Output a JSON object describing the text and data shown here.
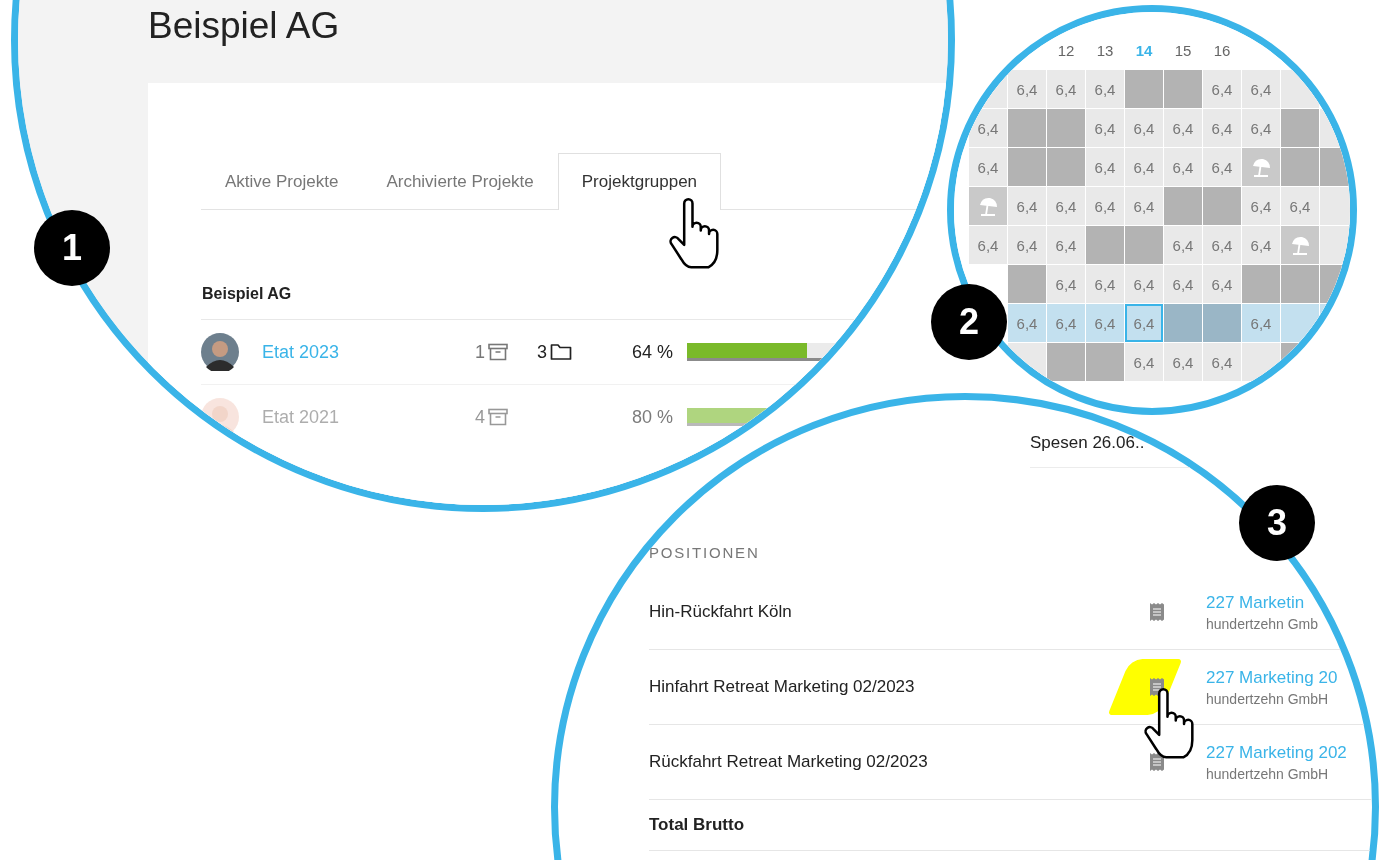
{
  "panel_1": {
    "badge": "1",
    "company_title": "Beispiel AG",
    "tabs": [
      {
        "label": "Aktive Projekte",
        "selected": false
      },
      {
        "label": "Archivierte Projekte",
        "selected": false
      },
      {
        "label": "Projektgruppen",
        "selected": true
      }
    ],
    "group": {
      "name": "Beispiel AG",
      "projects": [
        {
          "name": "Etat 2023",
          "archived_count": "1",
          "folder_count": "3",
          "percent": "64 %",
          "level": 0.64,
          "disabled": false
        },
        {
          "name": "Etat 2021",
          "archived_count": "4",
          "percent": "80 %",
          "level": 0.8,
          "disabled": true
        }
      ]
    }
  },
  "panel_2": {
    "badge": "2",
    "days": [
      {
        "label": "12",
        "today": false
      },
      {
        "label": "13",
        "today": false
      },
      {
        "label": "14",
        "today": true
      },
      {
        "label": "15",
        "today": false
      },
      {
        "label": "16",
        "today": false
      }
    ],
    "rows": [
      {
        "highlighted": false,
        "cells": [
          {
            "kind": "hours"
          },
          {
            "kind": "hours",
            "text": "6,4"
          },
          {
            "kind": "hours",
            "text": "6,4"
          },
          {
            "kind": "hours",
            "text": "6,4"
          },
          {
            "kind": "off"
          },
          {
            "kind": "off"
          },
          {
            "kind": "hours",
            "text": "6,4"
          },
          {
            "kind": "hours",
            "text": "6,4"
          },
          {
            "kind": "hours"
          },
          {
            "kind": "empty"
          }
        ]
      },
      {
        "highlighted": false,
        "cells": [
          {
            "kind": "hours",
            "text": "6,4"
          },
          {
            "kind": "off"
          },
          {
            "kind": "off"
          },
          {
            "kind": "hours",
            "text": "6,4"
          },
          {
            "kind": "hours",
            "text": "6,4"
          },
          {
            "kind": "hours",
            "text": "6,4"
          },
          {
            "kind": "hours",
            "text": "6,4"
          },
          {
            "kind": "hours",
            "text": "6,4"
          },
          {
            "kind": "off"
          },
          {
            "kind": "hours"
          }
        ]
      },
      {
        "highlighted": false,
        "cells": [
          {
            "kind": "hours",
            "text": "6,4"
          },
          {
            "kind": "off"
          },
          {
            "kind": "off"
          },
          {
            "kind": "hours",
            "text": "6,4"
          },
          {
            "kind": "hours",
            "text": "6,4"
          },
          {
            "kind": "hours",
            "text": "6,4"
          },
          {
            "kind": "hours",
            "text": "6,4"
          },
          {
            "kind": "vacation"
          },
          {
            "kind": "off"
          },
          {
            "kind": "off"
          }
        ]
      },
      {
        "highlighted": false,
        "cells": [
          {
            "kind": "vacation"
          },
          {
            "kind": "hours",
            "text": "6,4"
          },
          {
            "kind": "hours",
            "text": "6,4"
          },
          {
            "kind": "hours",
            "text": "6,4"
          },
          {
            "kind": "hours",
            "text": "6,4"
          },
          {
            "kind": "off"
          },
          {
            "kind": "off"
          },
          {
            "kind": "hours",
            "text": "6,4"
          },
          {
            "kind": "hours",
            "text": "6,4"
          },
          {
            "kind": "hours"
          }
        ]
      },
      {
        "highlighted": false,
        "cells": [
          {
            "kind": "hours",
            "text": "6,4"
          },
          {
            "kind": "hours",
            "text": "6,4"
          },
          {
            "kind": "hours",
            "text": "6,4"
          },
          {
            "kind": "off"
          },
          {
            "kind": "off"
          },
          {
            "kind": "hours",
            "text": "6,4"
          },
          {
            "kind": "hours",
            "text": "6,4"
          },
          {
            "kind": "hours",
            "text": "6,4"
          },
          {
            "kind": "vacation"
          },
          {
            "kind": "hours"
          }
        ]
      },
      {
        "highlighted": false,
        "cells": [
          {
            "kind": "empty"
          },
          {
            "kind": "off"
          },
          {
            "kind": "hours",
            "text": "6,4"
          },
          {
            "kind": "hours",
            "text": "6,4"
          },
          {
            "kind": "hours",
            "text": "6,4"
          },
          {
            "kind": "hours",
            "text": "6,4"
          },
          {
            "kind": "hours",
            "text": "6,4"
          },
          {
            "kind": "off"
          },
          {
            "kind": "off"
          },
          {
            "kind": "off"
          }
        ]
      },
      {
        "highlighted": true,
        "cells": [
          {
            "kind": "empty"
          },
          {
            "kind": "hours",
            "text": "6,4"
          },
          {
            "kind": "hours",
            "text": "6,4"
          },
          {
            "kind": "hours",
            "text": "6,4"
          },
          {
            "kind": "hours",
            "text": "6,4",
            "selected": true
          },
          {
            "kind": "off"
          },
          {
            "kind": "off"
          },
          {
            "kind": "hours",
            "text": "6,4"
          },
          {
            "kind": "hours"
          },
          {
            "kind": "hours"
          }
        ]
      },
      {
        "highlighted": false,
        "cells": [
          {
            "kind": "empty"
          },
          {
            "kind": "hours"
          },
          {
            "kind": "off"
          },
          {
            "kind": "off"
          },
          {
            "kind": "hours",
            "text": "6,4"
          },
          {
            "kind": "hours",
            "text": "6,4"
          },
          {
            "kind": "hours",
            "text": "6,4"
          },
          {
            "kind": "hours"
          },
          {
            "kind": "off"
          },
          {
            "kind": "empty"
          }
        ]
      }
    ]
  },
  "panel_3": {
    "badge": "3",
    "expense_title": "Spesen 26.06..",
    "section_label": "POSITIONEN",
    "positions": [
      {
        "title": "Hin-Rückfahrt Köln",
        "project": "227 Marketin",
        "client": "hundertzehn Gmb",
        "highlighted": false
      },
      {
        "title": "Hinfahrt Retreat Marketing 02/2023",
        "project": "227 Marketing 20",
        "client": "hundertzehn GmbH",
        "highlighted": true
      },
      {
        "title": "Rückfahrt Retreat Marketing 02/2023",
        "project": "227 Marketing 202",
        "client": "hundertzehn GmbH",
        "highlighted": false
      }
    ],
    "total_label": "Total Brutto"
  }
}
